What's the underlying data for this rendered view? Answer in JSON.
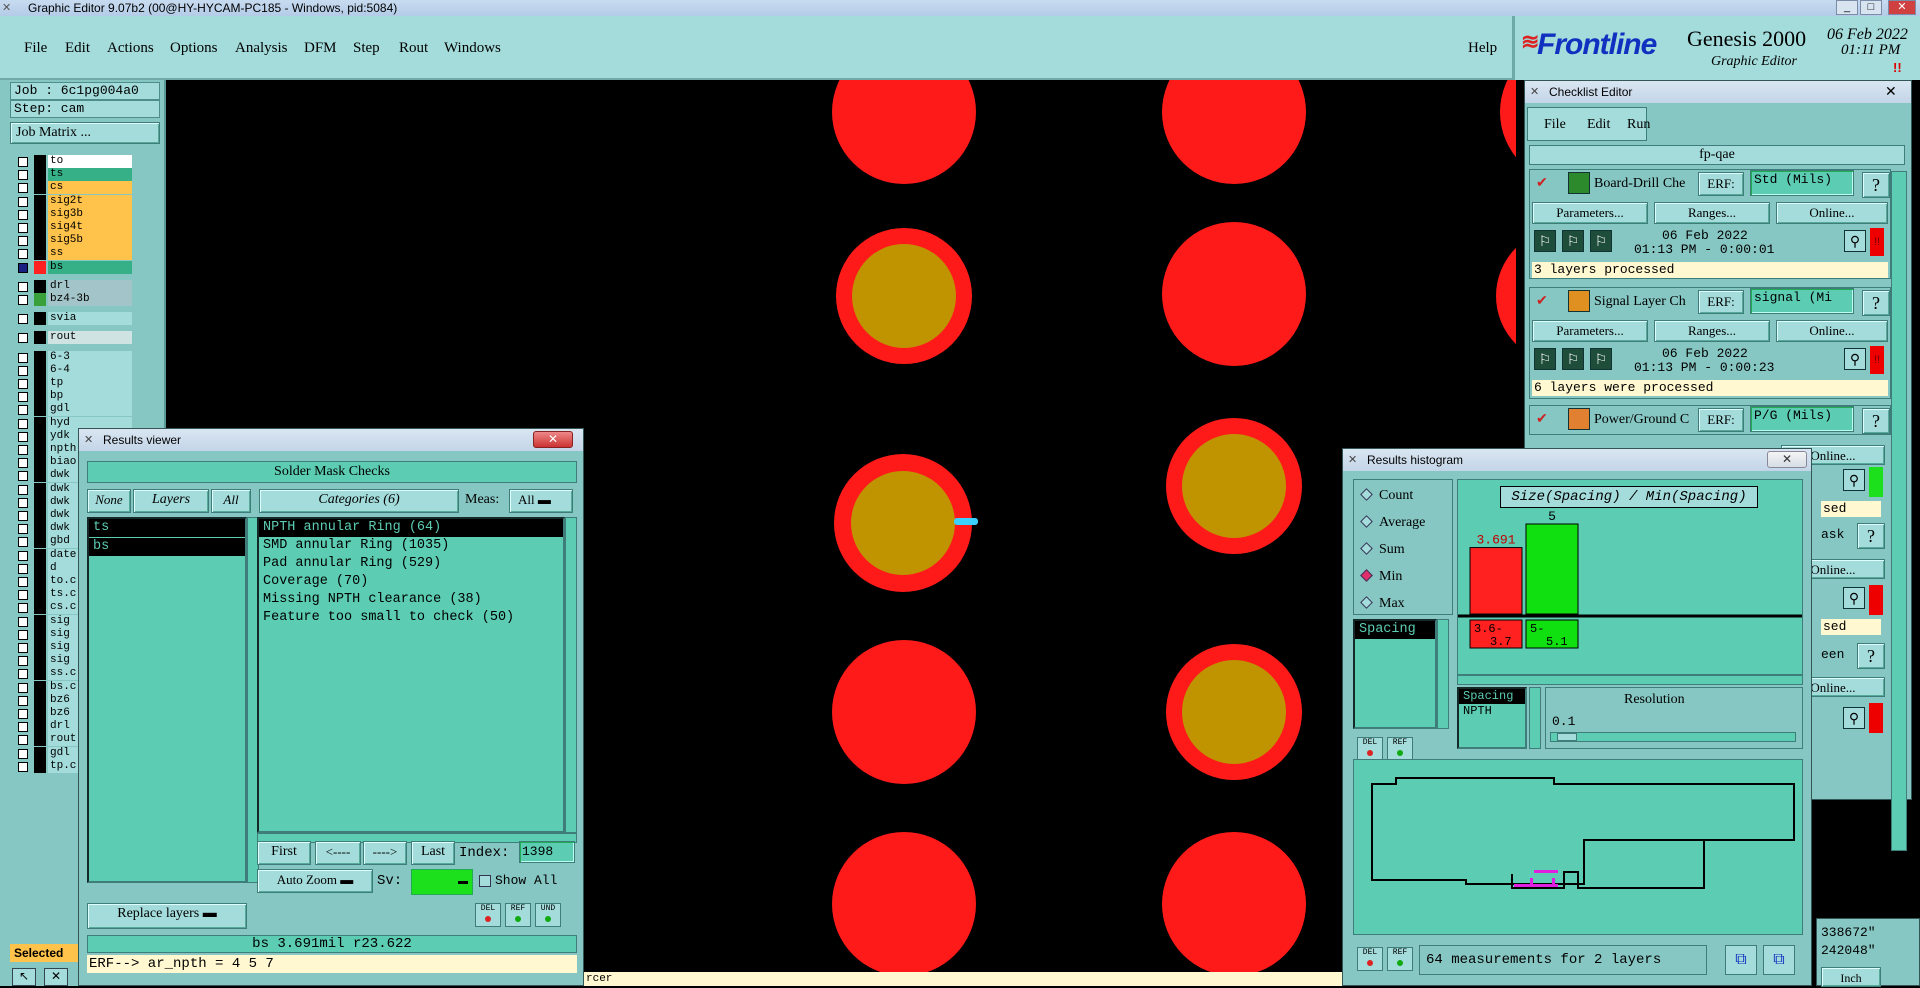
{
  "app": {
    "title": "Graphic Editor 9.07b2 (00@HY-HYCAM-PC185 - Windows, pid:5084)",
    "min": "_",
    "max": "□",
    "close": "✕"
  },
  "menu": [
    "File",
    "Edit",
    "Actions",
    "Options",
    "Analysis",
    "DFM",
    "Step",
    "Rout",
    "Windows"
  ],
  "help": "Help",
  "brand": {
    "logo": "Frontline",
    "product": "Genesis 2000",
    "sub": "Graphic Editor",
    "date": "06 Feb 2022",
    "time": "01:11 PM",
    "alert": "!!"
  },
  "left": {
    "job": "Job : 6c1pg004a0",
    "step": "Step: cam",
    "job_matrix": "Job Matrix ...",
    "selected": "Selected",
    "layers": [
      {
        "name": "to",
        "color": "#ffffff"
      },
      {
        "name": "ts",
        "color": "#36b087"
      },
      {
        "name": "cs",
        "color": "#ffc24a"
      },
      {
        "name": "sig2t",
        "color": "#ffc24a"
      },
      {
        "name": "sig3b",
        "color": "#ffc24a"
      },
      {
        "name": "sig4t",
        "color": "#ffc24a"
      },
      {
        "name": "sig5b",
        "color": "#ffc24a"
      },
      {
        "name": "ss",
        "color": "#ffc24a"
      },
      {
        "name": "bs",
        "color": "#36b087"
      },
      {
        "name": "drl",
        "color": "#a3c4c8"
      },
      {
        "name": "bz4-3b",
        "color": "#a3c4c8"
      },
      {
        "name": "svia",
        "color": "#a3dcdb"
      },
      {
        "name": "rout",
        "color": "#cfe3e3"
      },
      {
        "name": "6-3",
        "color": "#a3dcdb"
      },
      {
        "name": "6-4",
        "color": "#a3dcdb"
      },
      {
        "name": "tp",
        "color": "#a3dcdb"
      },
      {
        "name": "bp",
        "color": "#a3dcdb"
      },
      {
        "name": "gdl",
        "color": "#a3dcdb"
      },
      {
        "name": "hyd",
        "color": "#a3dcdb"
      },
      {
        "name": "ydk",
        "color": "#a3dcdb"
      },
      {
        "name": "npth",
        "color": "#a3dcdb"
      },
      {
        "name": "biao",
        "color": "#a3dcdb"
      },
      {
        "name": "dwk",
        "color": "#a3dcdb"
      },
      {
        "name": "dwk",
        "color": "#a3dcdb"
      },
      {
        "name": "dwk",
        "color": "#a3dcdb"
      },
      {
        "name": "dwk",
        "color": "#a3dcdb"
      },
      {
        "name": "dwk",
        "color": "#a3dcdb"
      },
      {
        "name": "gbd",
        "color": "#a3dcdb"
      },
      {
        "name": "date",
        "color": "#a3dcdb"
      },
      {
        "name": "d",
        "color": "#a3dcdb"
      },
      {
        "name": "to.c",
        "color": "#a3dcdb"
      },
      {
        "name": "ts.c",
        "color": "#a3dcdb"
      },
      {
        "name": "cs.c",
        "color": "#a3dcdb"
      },
      {
        "name": "sig",
        "color": "#a3dcdb"
      },
      {
        "name": "sig",
        "color": "#a3dcdb"
      },
      {
        "name": "sig",
        "color": "#a3dcdb"
      },
      {
        "name": "sig",
        "color": "#a3dcdb"
      },
      {
        "name": "ss.c",
        "color": "#a3dcdb"
      },
      {
        "name": "bs.c",
        "color": "#a3dcdb"
      },
      {
        "name": "bz6",
        "color": "#a3dcdb"
      },
      {
        "name": "bz6",
        "color": "#a3dcdb"
      },
      {
        "name": "drl",
        "color": "#a3dcdb"
      },
      {
        "name": "rout",
        "color": "#a3dcdb"
      },
      {
        "name": "gdl",
        "color": "#a3dcdb"
      },
      {
        "name": "tp.c",
        "color": "#a3dcdb"
      }
    ]
  },
  "results_viewer": {
    "title": "Results viewer",
    "header": "Solder Mask Checks",
    "none": "None",
    "layers": "Layers",
    "all": "All",
    "categories": "Categories (6)",
    "meas_label": "Meas:",
    "meas_value": "All",
    "layer_list": [
      "ts",
      "bs"
    ],
    "category_list": [
      "NPTH annular Ring (64)",
      "SMD annular Ring (1035)",
      "Pad annular Ring (529)",
      "Coverage (70)",
      "Missing NPTH clearance (38)",
      "Feature too small to check (50)"
    ],
    "first": "First",
    "prev": "<----",
    "next": "---->",
    "last": "Last",
    "index_label": "Index:",
    "index_value": "1398",
    "auto_zoom": "Auto Zoom",
    "sv_label": "Sv:",
    "show_all": "Show All",
    "replace_layers": "Replace layers",
    "del": "DEL",
    "ref": "REF",
    "und": "UND",
    "status": "bs 3.691mil  r23.622",
    "erf": "ERF--> ar_npth = 4 5 7"
  },
  "histogram": {
    "title": "Results histogram",
    "modes": [
      "Count",
      "Average",
      "Sum",
      "Min",
      "Max"
    ],
    "selected_mode": "Min",
    "category": "Spacing",
    "chart_title": "Size(Spacing) / Min(Spacing)",
    "resolution_label": "Resolution",
    "resolution_value": "0.1",
    "list2": [
      "Spacing",
      "NPTH"
    ],
    "footer": "64 measurements for 2 layers",
    "del": "DEL",
    "ref": "REF"
  },
  "chart_data": {
    "type": "bar",
    "title": "Size(Spacing) / Min(Spacing)",
    "categories": [
      "3.6-3.7",
      "5-5.1"
    ],
    "category_lines": [
      [
        "3.6-",
        "3.7"
      ],
      [
        "5-",
        "5.1"
      ]
    ],
    "values": [
      3.691,
      5
    ],
    "value_labels": [
      "3.691",
      "5"
    ],
    "colors": [
      "#ff2020",
      "#10e010"
    ],
    "ylim": [
      0,
      5
    ]
  },
  "checklist": {
    "title": "Checklist Editor",
    "menu": [
      "File",
      "Edit",
      "Run"
    ],
    "name": "fp-qae",
    "erf_label": "ERF:",
    "parameters": "Parameters...",
    "ranges": "Ranges...",
    "online": "Online...",
    "items": [
      {
        "name": "Board-Drill Che",
        "erf": "Std (Mils)",
        "date": "06 Feb 2022",
        "time": "01:13 PM - 0:00:01",
        "status": "3 layers processed"
      },
      {
        "name": "Signal Layer Ch",
        "erf": "signal (Mi",
        "date": "06 Feb 2022",
        "time": "01:13 PM - 0:00:23",
        "status": "6 layers were processed"
      },
      {
        "name": "Power/Ground C",
        "erf": "P/G (Mils)",
        "date": "",
        "time": "",
        "status": ""
      }
    ],
    "hidden_fragments": [
      "sed",
      "ask",
      "een",
      "sed"
    ]
  },
  "coords": {
    "x": "338672\"",
    "y": "242048\"",
    "unit": "Inch"
  },
  "bottom_text": "rcer"
}
